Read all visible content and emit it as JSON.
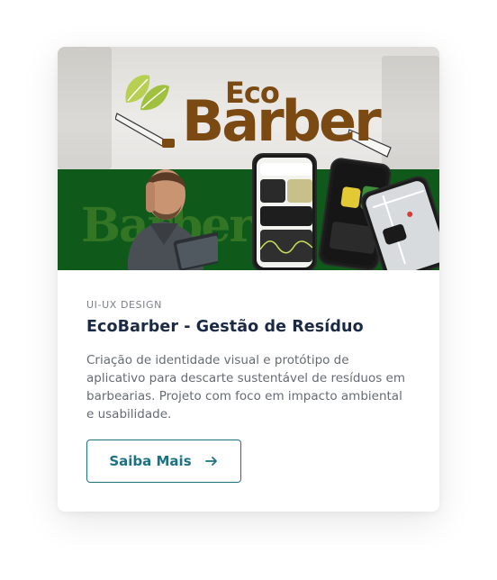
{
  "card": {
    "image": {
      "logo_eco": "Eco",
      "logo_barber": "Barber",
      "ghost_logo": "Barber"
    },
    "category": "UI-UX DESIGN",
    "title": "EcoBarber - Gestão de Resíduo",
    "description": "Criação de identidade visual e protótipo de aplicativo para descarte sustentável de resíduos em barbearias. Projeto com foco em impacto ambiental e usabilidade.",
    "cta": {
      "label": "Saiba Mais",
      "icon": "arrow-right-icon"
    }
  },
  "colors": {
    "accent": "#1c7281",
    "title": "#1b2a44",
    "brand_brown": "#7a4a12",
    "brand_green": "#0f5a1a"
  }
}
